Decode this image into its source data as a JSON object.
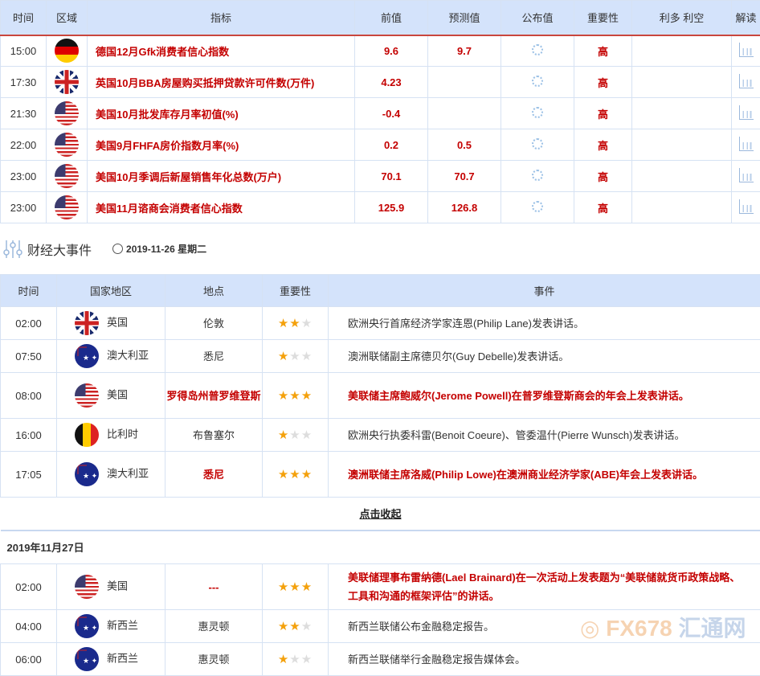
{
  "indicators": {
    "headers": [
      "时间",
      "区域",
      "指标",
      "前值",
      "预测值",
      "公布值",
      "重要性",
      "利多 利空",
      "解读"
    ],
    "rows": [
      {
        "time": "15:00",
        "flag": "de",
        "name": "德国12月Gfk消费者信心指数",
        "prev": "9.6",
        "forecast": "9.7",
        "importance": "高"
      },
      {
        "time": "17:30",
        "flag": "gb",
        "name": "英国10月BBA房屋购买抵押贷款许可件数(万件)",
        "prev": "4.23",
        "forecast": "",
        "importance": "高"
      },
      {
        "time": "21:30",
        "flag": "us",
        "name": "美国10月批发库存月率初值(%)",
        "prev": "-0.4",
        "forecast": "",
        "importance": "高"
      },
      {
        "time": "22:00",
        "flag": "us",
        "name": "美国9月FHFA房价指数月率(%)",
        "prev": "0.2",
        "forecast": "0.5",
        "importance": "高"
      },
      {
        "time": "23:00",
        "flag": "us",
        "name": "美国10月季调后新屋销售年化总数(万户)",
        "prev": "70.1",
        "forecast": "70.7",
        "importance": "高"
      },
      {
        "time": "23:00",
        "flag": "us",
        "name": "美国11月谘商会消费者信心指数",
        "prev": "125.9",
        "forecast": "126.8",
        "importance": "高"
      }
    ]
  },
  "events_section": {
    "title": "财经大事件",
    "date": "2019-11-26 星期二"
  },
  "events": {
    "headers": [
      "时间",
      "国家地区",
      "地点",
      "重要性",
      "事件"
    ],
    "rows": [
      {
        "time": "02:00",
        "flag": "gb",
        "country": "英国",
        "place": "伦敦",
        "stars": 2,
        "event": "欧洲央行首席经济学家连恩(Philip Lane)发表讲话。",
        "hi": false
      },
      {
        "time": "07:50",
        "flag": "au",
        "country": "澳大利亚",
        "place": "悉尼",
        "stars": 1,
        "event": "澳洲联储副主席德贝尔(Guy Debelle)发表讲话。",
        "hi": false
      },
      {
        "time": "08:00",
        "flag": "us",
        "country": "美国",
        "place": "罗得岛州普罗维登斯",
        "stars": 3,
        "event": "美联储主席鲍威尔(Jerome Powell)在普罗维登斯商会的年会上发表讲话。",
        "hi": true
      },
      {
        "time": "16:00",
        "flag": "be",
        "country": "比利时",
        "place": "布鲁塞尔",
        "stars": 1,
        "event": "欧洲央行执委科雷(Benoit Coeure)、管委温什(Pierre Wunsch)发表讲话。",
        "hi": false
      },
      {
        "time": "17:05",
        "flag": "au",
        "country": "澳大利亚",
        "place": "悉尼",
        "stars": 3,
        "event": "澳洲联储主席洛威(Philip Lowe)在澳洲商业经济学家(ABE)年会上发表讲话。",
        "hi": true
      }
    ],
    "collapse_label": "点击收起",
    "next_day": "2019年11月27日",
    "rows2": [
      {
        "time": "02:00",
        "flag": "us",
        "country": "美国",
        "place": "---",
        "stars": 3,
        "event": "美联储理事布雷纳德(Lael Brainard)在一次活动上发表题为“美联储就货币政策战略、工具和沟通的框架评估”的讲话。",
        "hi": true
      },
      {
        "time": "04:00",
        "flag": "au",
        "country": "新西兰",
        "place": "惠灵顿",
        "stars": 2,
        "event": "新西兰联储公布金融稳定报告。",
        "hi": false
      },
      {
        "time": "06:00",
        "flag": "au",
        "country": "新西兰",
        "place": "惠灵顿",
        "stars": 1,
        "event": "新西兰联储举行金融稳定报告媒体会。",
        "hi": false
      }
    ]
  },
  "watermark": {
    "text": "FX678",
    "text2": "汇通网"
  },
  "colors": {
    "accent_red": "#c40000",
    "header_bg": "#d4e3fb",
    "star": "#f4a10c"
  }
}
